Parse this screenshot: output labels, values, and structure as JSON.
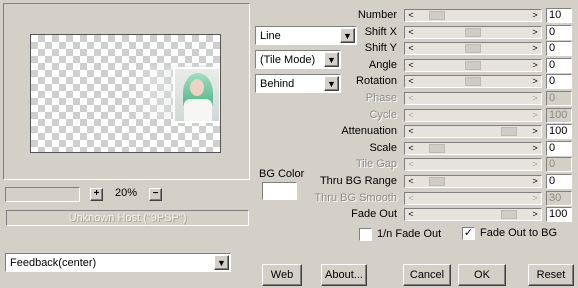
{
  "preview": {
    "zoom_value": "20%",
    "zoom_plus": "+",
    "zoom_minus": "−",
    "host_text": "Unknown Host (\"9PSP\")"
  },
  "dropdowns": {
    "feedback": "Feedback(center)",
    "line": "Line",
    "tile_mode": "(Tile Mode)",
    "behind": "Behind"
  },
  "bg_color": {
    "label": "BG Color",
    "color": "#ffffff"
  },
  "params": [
    {
      "label": "Number",
      "value": "10",
      "disabled": false,
      "pos": 0.13
    },
    {
      "label": "Shift X",
      "value": "0",
      "disabled": false,
      "pos": 0.5
    },
    {
      "label": "Shift Y",
      "value": "0",
      "disabled": false,
      "pos": 0.5
    },
    {
      "label": "Angle",
      "value": "0",
      "disabled": false,
      "pos": 0.5
    },
    {
      "label": "Rotation",
      "value": "0",
      "disabled": false,
      "pos": 0.5
    },
    {
      "label": "Phase",
      "value": "0",
      "disabled": true,
      "pos": 0.0
    },
    {
      "label": "Cycle",
      "value": "100",
      "disabled": true,
      "pos": 1.0
    },
    {
      "label": "Attenuation",
      "value": "100",
      "disabled": false,
      "pos": 0.88
    },
    {
      "label": "Scale",
      "value": "0",
      "disabled": false,
      "pos": 0.12
    },
    {
      "label": "Tile Gap",
      "value": "0",
      "disabled": true,
      "pos": 0.0
    },
    {
      "label": "Thru BG Range",
      "value": "0",
      "disabled": false,
      "pos": 0.12
    },
    {
      "label": "Thru BG Smooth",
      "value": "30",
      "disabled": true,
      "pos": 0.3
    },
    {
      "label": "Fade Out",
      "value": "100",
      "disabled": false,
      "pos": 0.88
    }
  ],
  "checkboxes": {
    "one_n_fade_out": {
      "label": "1/n Fade Out",
      "checked": false
    },
    "fade_out_to_bg": {
      "label": "Fade Out to BG",
      "checked": true
    }
  },
  "buttons": {
    "web": "Web",
    "about": "About...",
    "cancel": "Cancel",
    "ok": "OK",
    "reset": "Reset"
  }
}
